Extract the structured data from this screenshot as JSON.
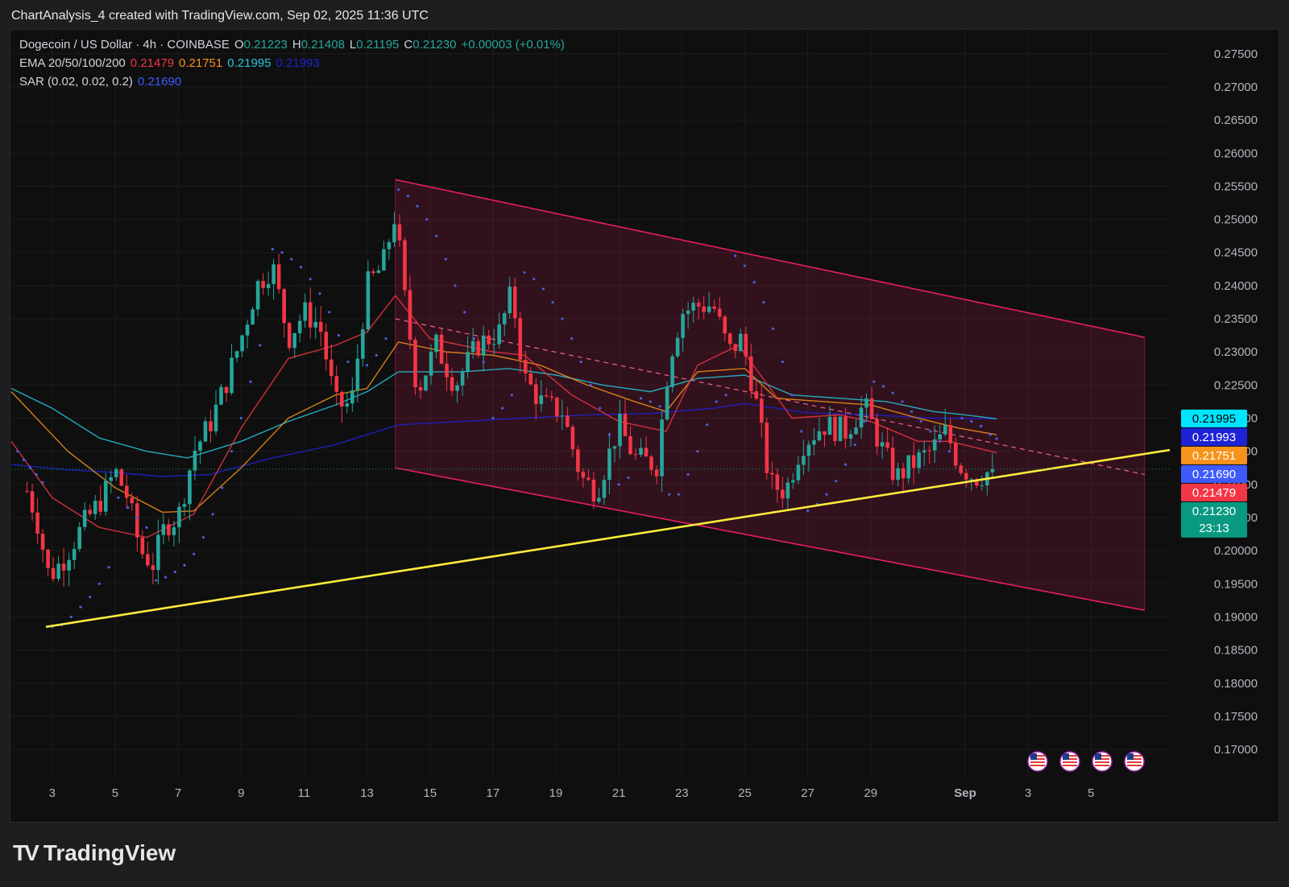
{
  "header": {
    "caption": "ChartAnalysis_4 created with TradingView.com, Sep 02, 2025 11:36 UTC"
  },
  "legend": {
    "symbol": "Dogecoin / US Dollar · 4h · COINBASE",
    "o_label": "O",
    "o": "0.21223",
    "h_label": "H",
    "h": "0.21408",
    "l_label": "L",
    "l": "0.21195",
    "c_label": "C",
    "c": "0.21230",
    "change": "+0.00003 (+0.01%)",
    "ema_label": "EMA 20/50/100/200",
    "ema20": "0.21479",
    "ema50": "0.21751",
    "ema100": "0.21995",
    "ema200": "0.21993",
    "sar_label": "SAR (0.02, 0.02, 0.2)",
    "sar": "0.21690"
  },
  "colors": {
    "up": "#26a69a",
    "down": "#f23645",
    "ema20": "#f23645",
    "ema50": "#f7931a",
    "ema100": "#26c6da",
    "ema200": "#1e22d6",
    "sar": "#4c5fe0",
    "trend": "#ffeb3b",
    "channel": "#e91e63",
    "price": "#089981"
  },
  "price_labels": [
    {
      "value": "0.21995",
      "price": 0.21995,
      "bg": "#00e5ff",
      "fg": "#000000"
    },
    {
      "value": "0.21993",
      "price": 0.21993,
      "bg": "#1e22d6",
      "fg": "#ffffff"
    },
    {
      "value": "0.21751",
      "price": 0.21751,
      "bg": "#f7931a",
      "fg": "#ffffff"
    },
    {
      "value": "0.21690",
      "price": 0.2169,
      "bg": "#3d5afe",
      "fg": "#ffffff"
    },
    {
      "value": "0.21479",
      "price": 0.21479,
      "bg": "#f23645",
      "fg": "#ffffff"
    },
    {
      "value": "0.21230",
      "price": 0.2123,
      "bg": "#089981",
      "fg": "#ffffff",
      "sub": "23:13"
    }
  ],
  "chart_data": {
    "type": "candlestick",
    "title": "Dogecoin / US Dollar · 4h · COINBASE",
    "y_ticks": [
      "0.27500",
      "0.27000",
      "0.26500",
      "0.26000",
      "0.25500",
      "0.25000",
      "0.24500",
      "0.24000",
      "0.23500",
      "0.23000",
      "0.22500",
      "0.22000",
      "0.21500",
      "0.21000",
      "0.20500",
      "0.20000",
      "0.19500",
      "0.19000",
      "0.18500",
      "0.18000",
      "0.17500",
      "0.17000"
    ],
    "ylim": [
      0.166,
      0.2785
    ],
    "x_ticks": [
      "3",
      "5",
      "7",
      "9",
      "11",
      "13",
      "15",
      "17",
      "19",
      "21",
      "23",
      "25",
      "27",
      "29",
      "Sep",
      "3",
      "5"
    ],
    "x_tick_days": [
      3,
      5,
      7,
      9,
      11,
      13,
      15,
      17,
      19,
      21,
      23,
      25,
      27,
      29,
      32,
      34,
      36
    ],
    "xlim_days": [
      1.7,
      38.5
    ],
    "last_price": 0.2123,
    "anchors": [
      [
        2.2,
        0.209
      ],
      [
        2.5,
        0.205
      ],
      [
        2.9,
        0.196
      ],
      [
        3.4,
        0.199
      ],
      [
        4.0,
        0.204
      ],
      [
        4.6,
        0.208
      ],
      [
        5.0,
        0.212
      ],
      [
        5.4,
        0.208
      ],
      [
        5.8,
        0.2
      ],
      [
        6.2,
        0.198
      ],
      [
        6.6,
        0.204
      ],
      [
        7.0,
        0.205
      ],
      [
        7.5,
        0.215
      ],
      [
        8.0,
        0.219
      ],
      [
        8.5,
        0.225
      ],
      [
        9.0,
        0.232
      ],
      [
        9.5,
        0.24
      ],
      [
        10.0,
        0.243
      ],
      [
        10.5,
        0.232
      ],
      [
        11.0,
        0.236
      ],
      [
        11.5,
        0.234
      ],
      [
        12.0,
        0.222
      ],
      [
        12.5,
        0.222
      ],
      [
        13.0,
        0.24
      ],
      [
        13.5,
        0.243
      ],
      [
        13.9,
        0.251
      ],
      [
        14.2,
        0.238
      ],
      [
        14.6,
        0.224
      ],
      [
        15.2,
        0.231
      ],
      [
        15.8,
        0.225
      ],
      [
        16.5,
        0.231
      ],
      [
        17.2,
        0.233
      ],
      [
        17.6,
        0.239
      ],
      [
        18.0,
        0.226
      ],
      [
        18.6,
        0.222
      ],
      [
        19.2,
        0.221
      ],
      [
        19.8,
        0.211
      ],
      [
        20.3,
        0.209
      ],
      [
        21.0,
        0.219
      ],
      [
        21.5,
        0.214
      ],
      [
        22.2,
        0.213
      ],
      [
        22.6,
        0.229
      ],
      [
        23.0,
        0.236
      ],
      [
        23.5,
        0.237
      ],
      [
        24.0,
        0.237
      ],
      [
        24.5,
        0.23
      ],
      [
        24.9,
        0.232
      ],
      [
        25.3,
        0.224
      ],
      [
        25.8,
        0.21
      ],
      [
        26.3,
        0.209
      ],
      [
        26.8,
        0.216
      ],
      [
        27.5,
        0.219
      ],
      [
        28.2,
        0.218
      ],
      [
        28.8,
        0.222
      ],
      [
        29.3,
        0.216
      ],
      [
        29.8,
        0.211
      ],
      [
        30.3,
        0.213
      ],
      [
        30.9,
        0.215
      ],
      [
        31.4,
        0.218
      ],
      [
        31.8,
        0.213
      ],
      [
        32.3,
        0.211
      ],
      [
        32.8,
        0.212
      ],
      [
        33.0,
        0.2123
      ]
    ],
    "ema20_pts": [
      [
        1.7,
        0.2165
      ],
      [
        3.0,
        0.208
      ],
      [
        4.5,
        0.2035
      ],
      [
        6.0,
        0.202
      ],
      [
        7.5,
        0.2055
      ],
      [
        9.0,
        0.2185
      ],
      [
        10.5,
        0.229
      ],
      [
        12.0,
        0.231
      ],
      [
        13.0,
        0.233
      ],
      [
        13.9,
        0.2385
      ],
      [
        15.0,
        0.232
      ],
      [
        17.0,
        0.23
      ],
      [
        18.0,
        0.2295
      ],
      [
        19.5,
        0.2235
      ],
      [
        21.0,
        0.2195
      ],
      [
        22.5,
        0.218
      ],
      [
        23.5,
        0.228
      ],
      [
        24.8,
        0.231
      ],
      [
        25.5,
        0.2265
      ],
      [
        26.5,
        0.22
      ],
      [
        28.0,
        0.2205
      ],
      [
        29.0,
        0.2195
      ],
      [
        30.5,
        0.2165
      ],
      [
        31.5,
        0.2165
      ],
      [
        33.0,
        0.2148
      ]
    ],
    "ema50_pts": [
      [
        1.7,
        0.224
      ],
      [
        3.5,
        0.215
      ],
      [
        5.0,
        0.2095
      ],
      [
        6.5,
        0.2058
      ],
      [
        7.5,
        0.206
      ],
      [
        9.0,
        0.2125
      ],
      [
        10.5,
        0.22
      ],
      [
        12.0,
        0.2235
      ],
      [
        13.0,
        0.2245
      ],
      [
        14.0,
        0.2315
      ],
      [
        15.5,
        0.23
      ],
      [
        17.0,
        0.2295
      ],
      [
        18.5,
        0.228
      ],
      [
        20.0,
        0.225
      ],
      [
        21.5,
        0.2225
      ],
      [
        22.5,
        0.221
      ],
      [
        23.5,
        0.227
      ],
      [
        25.0,
        0.2275
      ],
      [
        26.0,
        0.223
      ],
      [
        27.5,
        0.2225
      ],
      [
        29.0,
        0.222
      ],
      [
        30.5,
        0.22
      ],
      [
        31.8,
        0.2185
      ],
      [
        33.0,
        0.2175
      ]
    ],
    "ema100_pts": [
      [
        1.7,
        0.2245
      ],
      [
        3.0,
        0.2215
      ],
      [
        4.5,
        0.217
      ],
      [
        6.0,
        0.215
      ],
      [
        7.3,
        0.214
      ],
      [
        9.0,
        0.2165
      ],
      [
        10.5,
        0.2195
      ],
      [
        12.0,
        0.222
      ],
      [
        13.0,
        0.224
      ],
      [
        14.0,
        0.227
      ],
      [
        16.0,
        0.227
      ],
      [
        17.5,
        0.2275
      ],
      [
        19.0,
        0.2265
      ],
      [
        20.5,
        0.225
      ],
      [
        22.0,
        0.224
      ],
      [
        23.5,
        0.226
      ],
      [
        25.0,
        0.2265
      ],
      [
        26.5,
        0.2235
      ],
      [
        28.0,
        0.223
      ],
      [
        29.5,
        0.2225
      ],
      [
        31.0,
        0.221
      ],
      [
        32.0,
        0.2205
      ],
      [
        33.0,
        0.2199
      ]
    ],
    "ema200_pts": [
      [
        1.7,
        0.213
      ],
      [
        3.5,
        0.2122
      ],
      [
        5.0,
        0.2118
      ],
      [
        6.5,
        0.2112
      ],
      [
        8.0,
        0.2115
      ],
      [
        10.0,
        0.214
      ],
      [
        12.0,
        0.216
      ],
      [
        13.0,
        0.2175
      ],
      [
        14.0,
        0.219
      ],
      [
        16.0,
        0.2195
      ],
      [
        18.0,
        0.22
      ],
      [
        20.0,
        0.2205
      ],
      [
        22.0,
        0.2207
      ],
      [
        24.0,
        0.2215
      ],
      [
        25.0,
        0.2222
      ],
      [
        27.0,
        0.2208
      ],
      [
        29.0,
        0.2205
      ],
      [
        31.0,
        0.22
      ],
      [
        33.0,
        0.2199
      ]
    ],
    "sar_pts": [
      [
        1.9,
        0.215
      ],
      [
        2.1,
        0.2137
      ],
      [
        2.3,
        0.2125
      ],
      [
        2.5,
        0.2115
      ],
      [
        2.7,
        0.2103
      ],
      [
        3.0,
        0.1885
      ],
      [
        3.3,
        0.1888
      ],
      [
        3.6,
        0.19
      ],
      [
        3.9,
        0.1915
      ],
      [
        4.2,
        0.193
      ],
      [
        4.5,
        0.195
      ],
      [
        4.8,
        0.1975
      ],
      [
        5.1,
        0.208
      ],
      [
        5.4,
        0.2065
      ],
      [
        5.7,
        0.205
      ],
      [
        6.0,
        0.2035
      ],
      [
        6.3,
        0.1955
      ],
      [
        6.6,
        0.196
      ],
      [
        6.9,
        0.1968
      ],
      [
        7.2,
        0.1978
      ],
      [
        7.5,
        0.1995
      ],
      [
        7.8,
        0.202
      ],
      [
        8.1,
        0.2055
      ],
      [
        8.4,
        0.2095
      ],
      [
        8.7,
        0.215
      ],
      [
        9.0,
        0.22
      ],
      [
        9.3,
        0.2255
      ],
      [
        9.6,
        0.231
      ],
      [
        10.0,
        0.2455
      ],
      [
        10.3,
        0.245
      ],
      [
        10.6,
        0.244
      ],
      [
        10.9,
        0.2428
      ],
      [
        11.2,
        0.241
      ],
      [
        11.5,
        0.2388
      ],
      [
        11.8,
        0.236
      ],
      [
        12.1,
        0.2325
      ],
      [
        12.4,
        0.2285
      ],
      [
        13.0,
        0.228
      ],
      [
        13.3,
        0.2295
      ],
      [
        13.6,
        0.232
      ],
      [
        14.0,
        0.2545
      ],
      [
        14.3,
        0.2535
      ],
      [
        14.6,
        0.252
      ],
      [
        14.9,
        0.25
      ],
      [
        15.2,
        0.2475
      ],
      [
        15.5,
        0.244
      ],
      [
        15.8,
        0.24
      ],
      [
        16.1,
        0.236
      ],
      [
        16.4,
        0.232
      ],
      [
        16.7,
        0.2285
      ],
      [
        17.0,
        0.22
      ],
      [
        17.3,
        0.2215
      ],
      [
        17.6,
        0.2235
      ],
      [
        18.0,
        0.242
      ],
      [
        18.3,
        0.241
      ],
      [
        18.6,
        0.2395
      ],
      [
        18.9,
        0.2375
      ],
      [
        19.2,
        0.235
      ],
      [
        19.5,
        0.232
      ],
      [
        19.8,
        0.2285
      ],
      [
        20.1,
        0.225
      ],
      [
        20.4,
        0.2215
      ],
      [
        20.7,
        0.2175
      ],
      [
        21.0,
        0.21
      ],
      [
        21.3,
        0.211
      ],
      [
        21.7,
        0.223
      ],
      [
        22.0,
        0.2225
      ],
      [
        22.3,
        0.2218
      ],
      [
        22.6,
        0.2085
      ],
      [
        22.9,
        0.2085
      ],
      [
        23.2,
        0.2115
      ],
      [
        23.5,
        0.215
      ],
      [
        23.8,
        0.219
      ],
      [
        24.1,
        0.2225
      ],
      [
        24.4,
        0.2235
      ],
      [
        24.7,
        0.2445
      ],
      [
        25.0,
        0.243
      ],
      [
        25.3,
        0.2405
      ],
      [
        25.6,
        0.2375
      ],
      [
        25.9,
        0.2335
      ],
      [
        26.2,
        0.2285
      ],
      [
        26.5,
        0.2235
      ],
      [
        26.8,
        0.218
      ],
      [
        27.0,
        0.206
      ],
      [
        27.3,
        0.207
      ],
      [
        27.6,
        0.2085
      ],
      [
        27.9,
        0.2105
      ],
      [
        28.2,
        0.213
      ],
      [
        28.5,
        0.216
      ],
      [
        28.8,
        0.2195
      ],
      [
        29.1,
        0.2255
      ],
      [
        29.4,
        0.2248
      ],
      [
        29.7,
        0.2238
      ],
      [
        30.0,
        0.2225
      ],
      [
        30.3,
        0.221
      ],
      [
        30.6,
        0.2195
      ],
      [
        30.9,
        0.218
      ],
      [
        31.2,
        0.2165
      ],
      [
        31.5,
        0.215
      ],
      [
        31.9,
        0.22
      ],
      [
        32.2,
        0.2195
      ],
      [
        32.5,
        0.2188
      ],
      [
        32.8,
        0.2175
      ],
      [
        33.0,
        0.2169
      ]
    ],
    "channel": {
      "upper": [
        [
          13.9,
          0.256
        ],
        [
          37.7,
          0.2322
        ]
      ],
      "lower": [
        [
          13.9,
          0.2125
        ],
        [
          37.7,
          0.191
        ]
      ]
    },
    "mid_dashed": [
      [
        13.9,
        0.235
      ],
      [
        37.7,
        0.2115
      ]
    ],
    "trendline": [
      [
        2.8,
        0.1885
      ],
      [
        38.5,
        0.2152
      ]
    ]
  }
}
